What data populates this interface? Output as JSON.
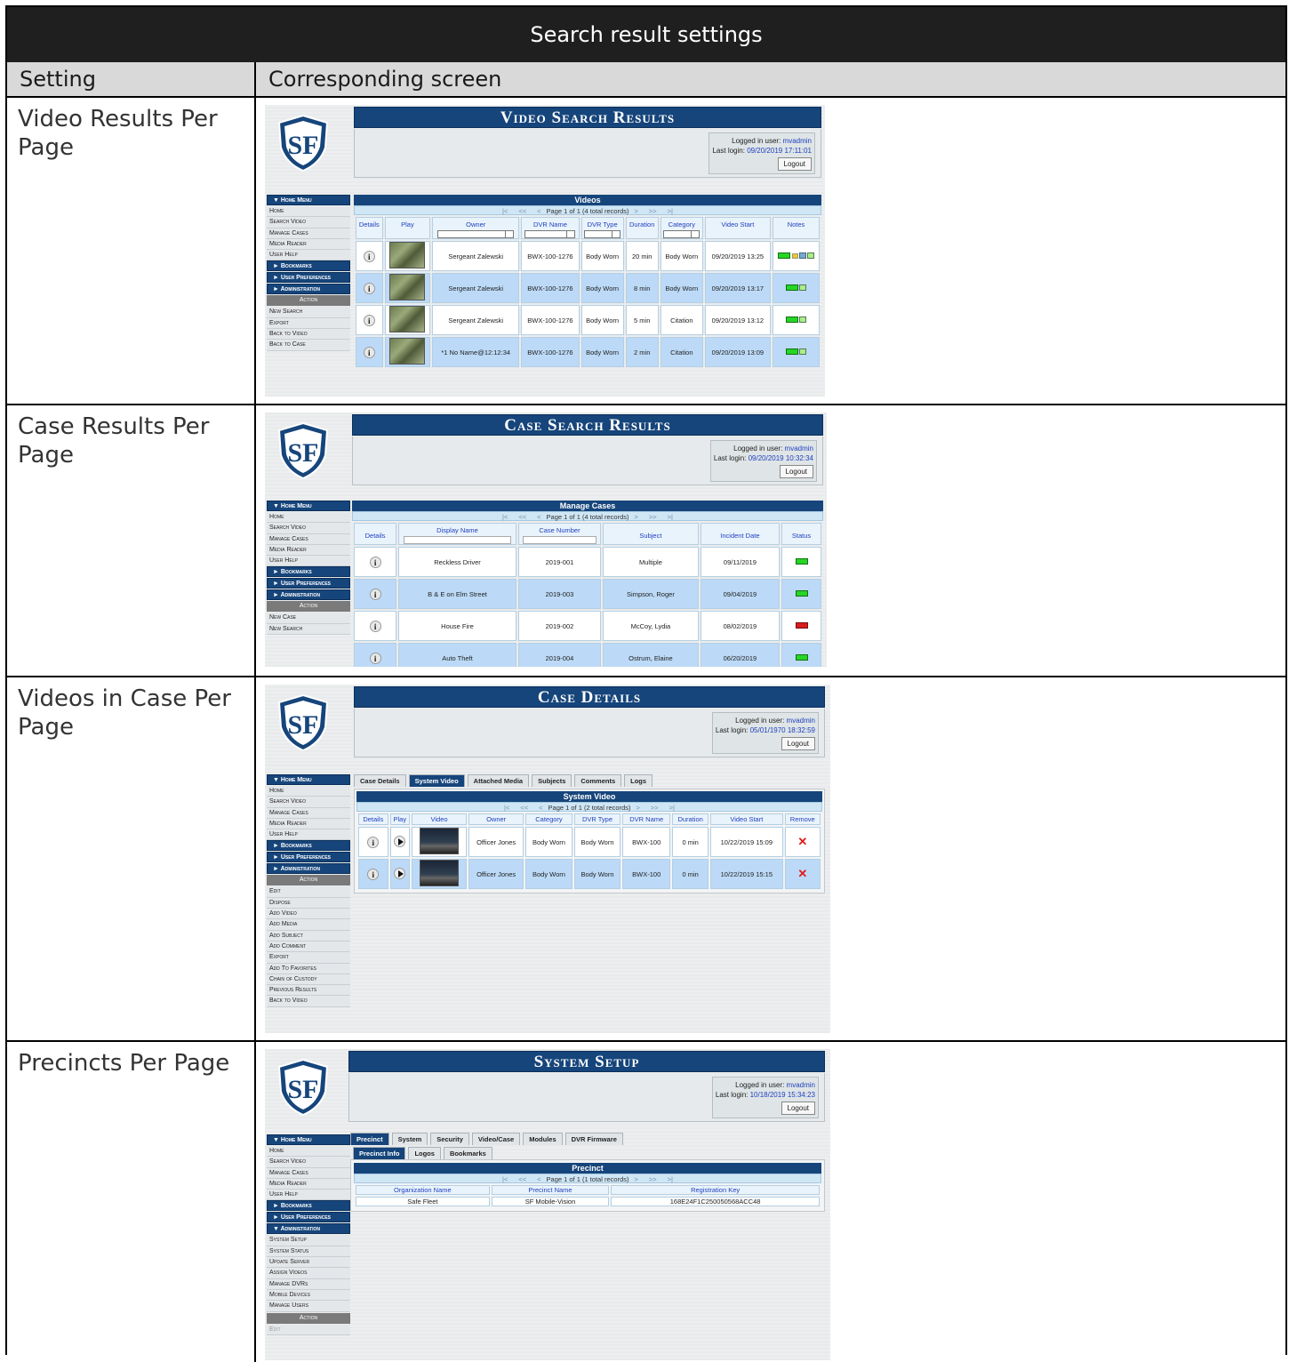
{
  "table_title": "Search result settings",
  "col_setting": "Setting",
  "col_screen": "Corresponding screen",
  "rows": [
    {
      "label": "Video Results Per Page"
    },
    {
      "label": "Case Results Per Page"
    },
    {
      "label": "Videos in Case Per Page"
    },
    {
      "label": "Precincts Per Page"
    }
  ],
  "common": {
    "logged_in_label": "Logged in user:",
    "user": "mvadmin",
    "last_login_label": "Last login:",
    "logout": "Logout",
    "home_menu": "▼ Home Menu",
    "bookmarks": "► Bookmarks",
    "user_prefs": "► User Preferences",
    "administration": "► Administration",
    "administration_open": "▼ Administration",
    "action": "Action",
    "nav_first": "|<",
    "nav_prev_prev": "<<",
    "nav_prev": "<",
    "nav_next": ">",
    "nav_next_next": ">>",
    "nav_last": ">|"
  },
  "home_items": [
    "Home",
    "Search Video",
    "Manage Cases",
    "Media Reader",
    "User Help"
  ],
  "screen1": {
    "banner": "Video Search Results",
    "last_login": "09/20/2019 17:11:01",
    "panel_title": "Videos",
    "pager": "Page 1 of 1 (4 total records)",
    "headers": [
      "Details",
      "Play",
      "Owner",
      "DVR Name",
      "DVR Type",
      "Duration",
      "Category",
      "Video Start",
      "Notes"
    ],
    "rows": [
      {
        "owner": "Sergeant Zalewski",
        "dvr": "BWX-100-1276",
        "type": "Body Worn",
        "dur": "20 min",
        "cat": "Body Worn",
        "start": "09/20/2019 13:25"
      },
      {
        "owner": "Sergeant Zalewski",
        "dvr": "BWX-100-1276",
        "type": "Body Worn",
        "dur": "8 min",
        "cat": "Body Worn",
        "start": "09/20/2019 13:17"
      },
      {
        "owner": "Sergeant Zalewski",
        "dvr": "BWX-100-1276",
        "type": "Body Worn",
        "dur": "5 min",
        "cat": "Citation",
        "start": "09/20/2019 13:12"
      },
      {
        "owner": "*1 No Name@12:12:34",
        "dvr": "BWX-100-1276",
        "type": "Body Worn",
        "dur": "2 min",
        "cat": "Citation",
        "start": "09/20/2019 13:09"
      }
    ],
    "actions": [
      "New Search",
      "Export",
      "Back to Video",
      "Back to Case"
    ]
  },
  "screen2": {
    "banner": "Case Search Results",
    "last_login": "09/20/2019 10:32:34",
    "panel_title": "Manage Cases",
    "pager": "Page 1 of 1 (4 total records)",
    "headers": [
      "Details",
      "Display Name",
      "Case Number",
      "Subject",
      "Incident Date",
      "Status"
    ],
    "rows": [
      {
        "name": "Reckless Driver",
        "num": "2019-001",
        "subj": "Multiple",
        "date": "09/11/2019",
        "status": "green"
      },
      {
        "name": "B & E on Elm Street",
        "num": "2019-003",
        "subj": "Simpson, Roger",
        "date": "09/04/2019",
        "status": "green"
      },
      {
        "name": "House Fire",
        "num": "2019-002",
        "subj": "McCoy, Lydia",
        "date": "08/02/2019",
        "status": "red"
      },
      {
        "name": "Auto Theft",
        "num": "2019-004",
        "subj": "Ostrum, Elaine",
        "date": "06/20/2019",
        "status": "green"
      }
    ],
    "actions": [
      "New Case",
      "New Search"
    ]
  },
  "screen3": {
    "banner": "Case Details",
    "last_login": "05/01/1970 18:32:59",
    "tabs": [
      "Case Details",
      "System Video",
      "Attached Media",
      "Subjects",
      "Comments",
      "Logs"
    ],
    "panel_title": "System Video",
    "pager": "Page 1 of 1 (2 total records)",
    "headers": [
      "Details",
      "Play",
      "Video",
      "Owner",
      "Category",
      "DVR Type",
      "DVR Name",
      "Duration",
      "Video Start",
      "Remove"
    ],
    "rows": [
      {
        "owner": "Officer Jones",
        "cat": "Body Worn",
        "type": "Body Worn",
        "dvr": "BWX-100",
        "dur": "0 min",
        "start": "10/22/2019 15:09",
        "remove": "✕"
      },
      {
        "owner": "Officer Jones",
        "cat": "Body Worn",
        "type": "Body Worn",
        "dvr": "BWX-100",
        "dur": "0 min",
        "start": "10/22/2019 15:15",
        "remove": "✕"
      }
    ],
    "actions": [
      "Edit",
      "Dispose",
      "Add Video",
      "Add Media",
      "Add Subject",
      "Add Comment",
      "Export",
      "Add To Favorites",
      "Chain of Custody",
      "Previous Results",
      "Back to Video"
    ]
  },
  "screen4": {
    "banner": "System Setup",
    "last_login": "10/18/2019 15:34:23",
    "tabs": [
      "Precinct",
      "System",
      "Security",
      "Video/Case",
      "Modules",
      "DVR Firmware"
    ],
    "subtabs": [
      "Precinct Info",
      "Logos",
      "Bookmarks"
    ],
    "panel_title": "Precinct",
    "pager": "Page 1 of 1 (1 total records)",
    "headers": [
      "Organization Name",
      "Precinct Name",
      "Registration Key"
    ],
    "rows": [
      {
        "org": "Safe Fleet",
        "prec": "SF Mobile-Vision",
        "key": "168E24F1C250050568ACC48"
      }
    ],
    "admin_items": [
      "System Setup",
      "System Status",
      "Update Server",
      "Assign Videos",
      "Manage DVRs",
      "Mobile Devices",
      "Manage Users"
    ],
    "actions": [
      "Edit"
    ]
  }
}
